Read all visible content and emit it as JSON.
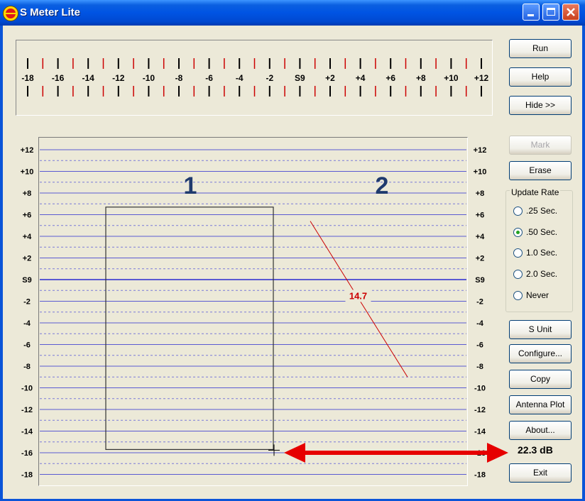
{
  "window": {
    "title": "S Meter Lite"
  },
  "meter": {
    "scale_labels": [
      "-18",
      "-16",
      "-14",
      "-12",
      "-10",
      "-8",
      "-6",
      "-4",
      "-2",
      "S9",
      "+2",
      "+4",
      "+6",
      "+8",
      "+10",
      "+12"
    ],
    "tick_color_major": "#000000",
    "tick_color_minor": "#cc0000"
  },
  "plot": {
    "y_labels": [
      "+12",
      "+10",
      "+8",
      "+6",
      "+4",
      "+2",
      "S9",
      "-2",
      "-4",
      "-6",
      "-8",
      "-10",
      "-12",
      "-14",
      "-16",
      "-18"
    ],
    "grid_color": "#5a5ad2",
    "zone1_label": "1",
    "zone2_label": "2",
    "zone_label_color": "#1f3a6e",
    "trace": {
      "start": 5.4,
      "end": -9.0,
      "label": "14.7",
      "color": "#cc0000"
    },
    "box_top": 6.7,
    "box_bottom": -15.7,
    "arrow_color": "#e60000"
  },
  "buttons": {
    "run": "Run",
    "help": "Help",
    "hide": "Hide >>",
    "mark": "Mark",
    "erase": "Erase",
    "s_unit": "S Unit",
    "configure": "Configure...",
    "copy": "Copy",
    "antenna_plot": "Antenna Plot",
    "about": "About...",
    "exit": "Exit"
  },
  "update_rate": {
    "label": "Update Rate",
    "options": [
      ".25 Sec.",
      ".50 Sec.",
      "1.0 Sec.",
      "2.0 Sec.",
      "Never"
    ],
    "selected": ".50 Sec."
  },
  "readout": "22.3 dB"
}
